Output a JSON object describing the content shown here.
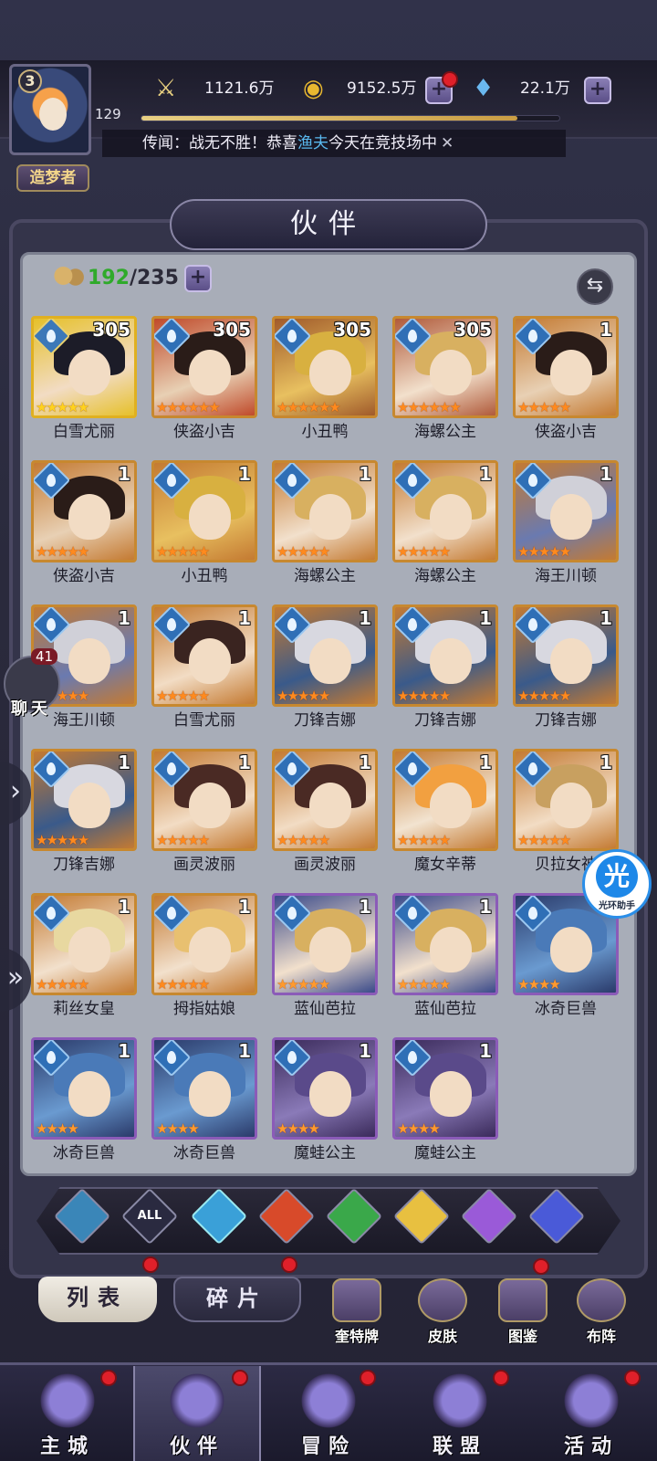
{
  "header": {
    "player_level": "3",
    "exp": "129",
    "exp_progress": 0.9,
    "title_badge": "造梦者",
    "power_value": "1121.6万",
    "gold_value": "9152.5万",
    "diamond_value": "22.1万",
    "news_prefix": "传闻：战无不胜！恭喜",
    "news_name": "渔夫",
    "news_suffix": "今天在竞技场中"
  },
  "page_title": "伙伴",
  "roster": {
    "current": "192",
    "max": "/235"
  },
  "heroes": [
    {
      "name": "白雪尤丽",
      "level": "305",
      "stars": 5,
      "rarity": "legend",
      "palette": [
        "#1c1c28",
        "#f2dcc4",
        "#e6c02a"
      ]
    },
    {
      "name": "侠盗小吉",
      "level": "305",
      "stars": 6,
      "rarity": "orange",
      "palette": [
        "#2a1c18",
        "#e8d0b4",
        "#c04a2a"
      ]
    },
    {
      "name": "小丑鸭",
      "level": "305",
      "stars": 6,
      "rarity": "orange",
      "palette": [
        "#d8b040",
        "#e8c060",
        "#a05a2a"
      ]
    },
    {
      "name": "海螺公主",
      "level": "305",
      "stars": 6,
      "rarity": "orange",
      "palette": [
        "#d8b060",
        "#f2e0cc",
        "#b05a3a"
      ]
    },
    {
      "name": "侠盗小吉",
      "level": "1",
      "stars": 5,
      "rarity": "orange",
      "palette": [
        "#2a1c18",
        "#e8d0b4",
        "#c47a32"
      ]
    },
    {
      "name": "侠盗小吉",
      "level": "1",
      "stars": 5,
      "rarity": "orange",
      "palette": [
        "#2a1c18",
        "#e8d0b4",
        "#c47a32"
      ]
    },
    {
      "name": "小丑鸭",
      "level": "1",
      "stars": 5,
      "rarity": "orange",
      "palette": [
        "#d8b040",
        "#e8c060",
        "#c47a32"
      ]
    },
    {
      "name": "海螺公主",
      "level": "1",
      "stars": 5,
      "rarity": "orange",
      "palette": [
        "#d8b060",
        "#f2e0cc",
        "#c47a32"
      ]
    },
    {
      "name": "海螺公主",
      "level": "1",
      "stars": 5,
      "rarity": "orange",
      "palette": [
        "#d8b060",
        "#f2e0cc",
        "#c47a32"
      ]
    },
    {
      "name": "海王川顿",
      "level": "1",
      "stars": 5,
      "rarity": "orange",
      "palette": [
        "#d0d0d8",
        "#6a7ab0",
        "#c47a32"
      ]
    },
    {
      "name": "海王川顿",
      "level": "1",
      "stars": 5,
      "rarity": "orange",
      "palette": [
        "#d0d0d8",
        "#6a7ab0",
        "#c47a32"
      ]
    },
    {
      "name": "白雪尤丽",
      "level": "1",
      "stars": 5,
      "rarity": "orange",
      "palette": [
        "#3a2420",
        "#f2dcc4",
        "#c47a32"
      ]
    },
    {
      "name": "刀锋吉娜",
      "level": "1",
      "stars": 5,
      "rarity": "orange",
      "palette": [
        "#d8d8e0",
        "#3a5a8a",
        "#c47a32"
      ]
    },
    {
      "name": "刀锋吉娜",
      "level": "1",
      "stars": 5,
      "rarity": "orange",
      "palette": [
        "#d8d8e0",
        "#3a5a8a",
        "#c47a32"
      ]
    },
    {
      "name": "刀锋吉娜",
      "level": "1",
      "stars": 5,
      "rarity": "orange",
      "palette": [
        "#d8d8e0",
        "#3a5a8a",
        "#c47a32"
      ]
    },
    {
      "name": "刀锋吉娜",
      "level": "1",
      "stars": 5,
      "rarity": "orange",
      "palette": [
        "#d8d8e0",
        "#3a5a8a",
        "#c47a32"
      ]
    },
    {
      "name": "画灵波丽",
      "level": "1",
      "stars": 5,
      "rarity": "orange",
      "palette": [
        "#4a2a24",
        "#f2dcc4",
        "#c47a32"
      ]
    },
    {
      "name": "画灵波丽",
      "level": "1",
      "stars": 5,
      "rarity": "orange",
      "palette": [
        "#4a2a24",
        "#f2dcc4",
        "#c47a32"
      ]
    },
    {
      "name": "魔女辛蒂",
      "level": "1",
      "stars": 5,
      "rarity": "orange",
      "palette": [
        "#f2a040",
        "#f2e3d0",
        "#c47a32"
      ]
    },
    {
      "name": "贝拉女神",
      "level": "1",
      "stars": 5,
      "rarity": "orange",
      "palette": [
        "#c8a060",
        "#f2dcc4",
        "#c47a32"
      ]
    },
    {
      "name": "莉丝女皇",
      "level": "1",
      "stars": 5,
      "rarity": "orange",
      "palette": [
        "#e8d8a0",
        "#f2e0cc",
        "#c47a32"
      ]
    },
    {
      "name": "拇指姑娘",
      "level": "1",
      "stars": 5,
      "rarity": "orange",
      "palette": [
        "#e8c070",
        "#f2e0cc",
        "#c47a32"
      ]
    },
    {
      "name": "蓝仙芭拉",
      "level": "1",
      "stars": 5,
      "rarity": "purple",
      "palette": [
        "#d8b060",
        "#f2e0cc",
        "#3a4a8a"
      ]
    },
    {
      "name": "蓝仙芭拉",
      "level": "1",
      "stars": 5,
      "rarity": "purple",
      "palette": [
        "#d8b060",
        "#f2e0cc",
        "#3a4a8a"
      ]
    },
    {
      "name": "冰奇巨兽",
      "level": "1",
      "stars": 4,
      "rarity": "purple",
      "palette": [
        "#4a7ab8",
        "#6a9ad0",
        "#2a3a6a"
      ]
    },
    {
      "name": "冰奇巨兽",
      "level": "1",
      "stars": 4,
      "rarity": "purple",
      "palette": [
        "#4a7ab8",
        "#6a9ad0",
        "#2a3a6a"
      ]
    },
    {
      "name": "冰奇巨兽",
      "level": "1",
      "stars": 4,
      "rarity": "purple",
      "palette": [
        "#4a7ab8",
        "#6a9ad0",
        "#2a3a6a"
      ]
    },
    {
      "name": "魔蛙公主",
      "level": "1",
      "stars": 4,
      "rarity": "purple",
      "palette": [
        "#5a4a8a",
        "#8a7ab8",
        "#3a2a5a"
      ]
    },
    {
      "name": "魔蛙公主",
      "level": "1",
      "stars": 4,
      "rarity": "purple",
      "palette": [
        "#5a4a8a",
        "#8a7ab8",
        "#3a2a5a"
      ]
    }
  ],
  "filters": [
    {
      "label": "",
      "icon": "chevron-up-icon",
      "color": "#3a86b8"
    },
    {
      "label": "ALL",
      "icon": "all-icon",
      "color": "#2a2a40"
    },
    {
      "label": "",
      "icon": "water-icon",
      "color": "#3aa0d8"
    },
    {
      "label": "",
      "icon": "fire-icon",
      "color": "#d84a2a"
    },
    {
      "label": "",
      "icon": "wind-icon",
      "color": "#3aa84a"
    },
    {
      "label": "",
      "icon": "light-icon",
      "color": "#e8c040"
    },
    {
      "label": "",
      "icon": "moon-icon",
      "color": "#9a5ad8"
    },
    {
      "label": "",
      "icon": "planet-icon",
      "color": "#4a5ad8"
    }
  ],
  "tabs": {
    "list": "列表",
    "fragments": "碎片"
  },
  "subbuttons": {
    "card": "奎特牌",
    "skin": "皮肤",
    "codex": "图鉴",
    "formation": "布阵"
  },
  "nav": {
    "city": "主城",
    "partner": "伙伴",
    "adventure": "冒险",
    "alliance": "联盟",
    "activity": "活动"
  },
  "chat": {
    "count": "41",
    "label": "聊天"
  },
  "helper": {
    "big": "光",
    "small": "光环助手"
  }
}
